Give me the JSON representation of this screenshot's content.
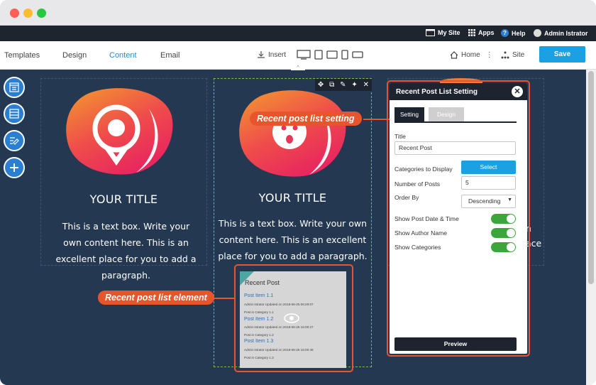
{
  "topbar": {
    "my_site": "My Site",
    "apps": "Apps",
    "help": "Help",
    "user": "Admin Istrator"
  },
  "toolbar": {
    "tabs": [
      "Templates",
      "Design",
      "Content",
      "Email"
    ],
    "active_tab": "Content",
    "insert": "Insert",
    "home": "Home",
    "site": "Site",
    "save": "Save"
  },
  "columns": [
    {
      "title": "YOUR TITLE",
      "text": "This is a text box. Write your own content here. This is an excellent place for you to add a paragraph."
    },
    {
      "title": "YOUR TITLE",
      "text": "This is a text box. Write your own content here. This is an excellent place for you to add a paragraph."
    },
    {
      "partial_text_1": "n",
      "partial_text_2": "ace"
    }
  ],
  "callouts": {
    "setting": "Recent post list setting",
    "element": "Recent post list element"
  },
  "recent_post": {
    "heading": "Recent Post",
    "items": [
      {
        "title": "Post Item 1.1",
        "meta": "Admin Istrator Updated on 2018-06-25 06:29:07",
        "cat": "Post in Category 1.1"
      },
      {
        "title": "Post Item 1.2",
        "meta": "Admin Istrator Updated on 2018-06-25 16:00:27",
        "cat": "Post in Category 1.2"
      },
      {
        "title": "Post Item 1.3",
        "meta": "Admin Istrator Updated on 2018-06-25 16:00:46",
        "cat": "Post in Category 1.3"
      }
    ]
  },
  "panel": {
    "title": "Recent Post List Setting",
    "tabs": [
      "Setting",
      "Design"
    ],
    "title_label": "Title",
    "title_value": "Recent Post",
    "categories_label": "Categories to Display",
    "select_label": "Select",
    "num_posts_label": "Number of Posts",
    "num_posts_value": "5",
    "order_label": "Order By",
    "order_value": "Descending",
    "toggles": [
      "Show Post Date & Time",
      "Show Author Name",
      "Show Categories"
    ],
    "preview": "Preview"
  },
  "colors": {
    "accent": "#1ba1e2",
    "callout": "#e8552d",
    "stage": "#243851",
    "toggle_on": "#3ca63c"
  }
}
